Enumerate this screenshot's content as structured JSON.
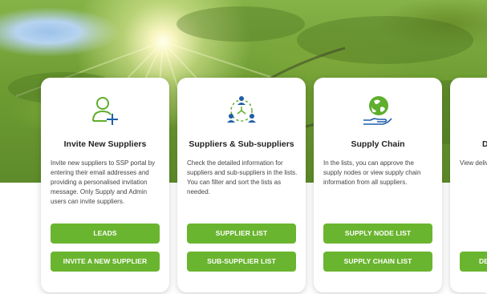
{
  "cards": [
    {
      "title": "Invite New Suppliers",
      "description": "Invite new suppliers to SSP portal by entering their email addresses and providing a personalised invitation message. Only Supply and Admin users can invite suppliers.",
      "icon": "add-user-icon",
      "buttons": [
        "LEADS",
        "INVITE A NEW SUPPLIER"
      ]
    },
    {
      "title": "Suppliers & Sub-suppliers",
      "description": "Check the detailed information for suppliers and sub-suppliers in the lists. You can filter and sort the lists as needed.",
      "icon": "network-icon",
      "buttons": [
        "SUPPLIER LIST",
        "SUB-SUPPLIER LIST"
      ]
    },
    {
      "title": "Supply Chain",
      "description": "In the lists, you can approve the supply nodes or view supply chain information from all suppliers.",
      "icon": "globe-hand-icon",
      "buttons": [
        "SUPPLY NODE LIST",
        "SUPPLY CHAIN LIST"
      ]
    },
    {
      "title": "D",
      "description": "View deliv suppliers, delivery fo",
      "icon": "delivery-icon",
      "buttons": [
        "DE"
      ]
    }
  ],
  "colors": {
    "accent": "#6ab52f",
    "icon_green": "#5fae2e",
    "icon_blue": "#1f5fa8"
  }
}
